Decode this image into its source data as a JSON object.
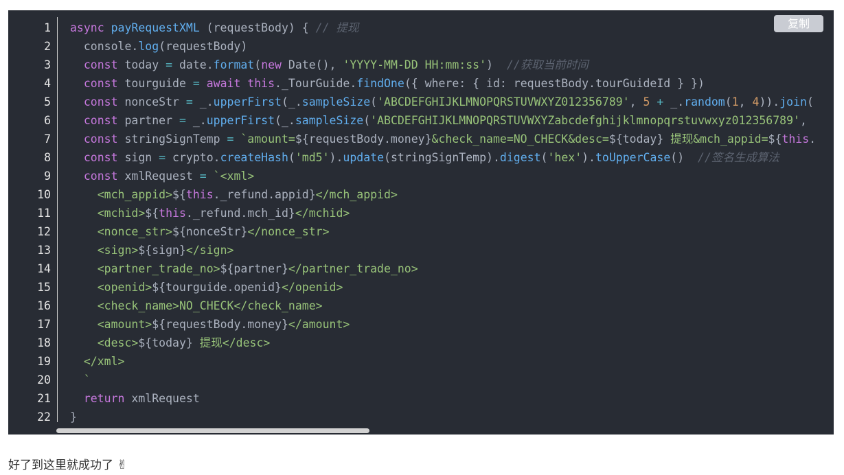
{
  "copy_button": {
    "label": "复制"
  },
  "line_numbers": [
    "1",
    "2",
    "3",
    "4",
    "5",
    "6",
    "7",
    "8",
    "9",
    "10",
    "11",
    "12",
    "13",
    "14",
    "15",
    "16",
    "17",
    "18",
    "19",
    "20",
    "21",
    "22"
  ],
  "code_lines": [
    [
      {
        "t": "kw",
        "v": "async "
      },
      {
        "t": "fn",
        "v": "payRequestXML"
      },
      {
        "t": "plain",
        "v": " (requestBody) { "
      },
      {
        "t": "cmt",
        "v": "// 提现"
      }
    ],
    [
      {
        "t": "plain",
        "v": "  console."
      },
      {
        "t": "fn",
        "v": "log"
      },
      {
        "t": "plain",
        "v": "(requestBody)"
      }
    ],
    [
      {
        "t": "plain",
        "v": "  "
      },
      {
        "t": "kw",
        "v": "const"
      },
      {
        "t": "plain",
        "v": " today "
      },
      {
        "t": "op",
        "v": "="
      },
      {
        "t": "plain",
        "v": " date."
      },
      {
        "t": "fn",
        "v": "format"
      },
      {
        "t": "plain",
        "v": "("
      },
      {
        "t": "kw",
        "v": "new"
      },
      {
        "t": "plain",
        "v": " Date(), "
      },
      {
        "t": "str",
        "v": "'YYYY-MM-DD HH:mm:ss'"
      },
      {
        "t": "plain",
        "v": ")  "
      },
      {
        "t": "cmt",
        "v": "//获取当前时间"
      }
    ],
    [
      {
        "t": "plain",
        "v": "  "
      },
      {
        "t": "kw",
        "v": "const"
      },
      {
        "t": "plain",
        "v": " tourguide "
      },
      {
        "t": "op",
        "v": "="
      },
      {
        "t": "plain",
        "v": " "
      },
      {
        "t": "kw",
        "v": "await this"
      },
      {
        "t": "plain",
        "v": "._TourGuide."
      },
      {
        "t": "fn",
        "v": "findOne"
      },
      {
        "t": "plain",
        "v": "({ where: { id: requestBody.tourGuideId } })"
      }
    ],
    [
      {
        "t": "plain",
        "v": "  "
      },
      {
        "t": "kw",
        "v": "const"
      },
      {
        "t": "plain",
        "v": " nonceStr "
      },
      {
        "t": "op",
        "v": "="
      },
      {
        "t": "plain",
        "v": " _."
      },
      {
        "t": "fn",
        "v": "upperFirst"
      },
      {
        "t": "plain",
        "v": "(_."
      },
      {
        "t": "fn",
        "v": "sampleSize"
      },
      {
        "t": "plain",
        "v": "("
      },
      {
        "t": "str",
        "v": "'ABCDEFGHIJKLMNOPQRSTUVWXYZ012356789'"
      },
      {
        "t": "plain",
        "v": ", "
      },
      {
        "t": "num",
        "v": "5"
      },
      {
        "t": "plain",
        "v": " "
      },
      {
        "t": "op",
        "v": "+"
      },
      {
        "t": "plain",
        "v": " _."
      },
      {
        "t": "fn",
        "v": "random"
      },
      {
        "t": "plain",
        "v": "("
      },
      {
        "t": "num",
        "v": "1"
      },
      {
        "t": "plain",
        "v": ", "
      },
      {
        "t": "num",
        "v": "4"
      },
      {
        "t": "plain",
        "v": "))."
      },
      {
        "t": "fn",
        "v": "join"
      },
      {
        "t": "plain",
        "v": "("
      }
    ],
    [
      {
        "t": "plain",
        "v": "  "
      },
      {
        "t": "kw",
        "v": "const"
      },
      {
        "t": "plain",
        "v": " partner "
      },
      {
        "t": "op",
        "v": "="
      },
      {
        "t": "plain",
        "v": " _."
      },
      {
        "t": "fn",
        "v": "upperFirst"
      },
      {
        "t": "plain",
        "v": "(_."
      },
      {
        "t": "fn",
        "v": "sampleSize"
      },
      {
        "t": "plain",
        "v": "("
      },
      {
        "t": "str",
        "v": "'ABCDEFGHIJKLMNOPQRSTUVWXYZabcdefghijklmnopqrstuvwxyz012356789'"
      },
      {
        "t": "plain",
        "v": ","
      }
    ],
    [
      {
        "t": "plain",
        "v": "  "
      },
      {
        "t": "kw",
        "v": "const"
      },
      {
        "t": "plain",
        "v": " stringSignTemp "
      },
      {
        "t": "op",
        "v": "="
      },
      {
        "t": "plain",
        "v": " "
      },
      {
        "t": "str",
        "v": "`amount="
      },
      {
        "t": "plain",
        "v": "${requestBody.money}"
      },
      {
        "t": "str",
        "v": "&check_name=NO_CHECK&desc="
      },
      {
        "t": "plain",
        "v": "${today}"
      },
      {
        "t": "str",
        "v": " 提现&mch_appid="
      },
      {
        "t": "plain",
        "v": "${"
      },
      {
        "t": "kw",
        "v": "this"
      },
      {
        "t": "plain",
        "v": "."
      }
    ],
    [
      {
        "t": "plain",
        "v": "  "
      },
      {
        "t": "kw",
        "v": "const"
      },
      {
        "t": "plain",
        "v": " sign "
      },
      {
        "t": "op",
        "v": "="
      },
      {
        "t": "plain",
        "v": " crypto."
      },
      {
        "t": "fn",
        "v": "createHash"
      },
      {
        "t": "plain",
        "v": "("
      },
      {
        "t": "str",
        "v": "'md5'"
      },
      {
        "t": "plain",
        "v": ")."
      },
      {
        "t": "fn",
        "v": "update"
      },
      {
        "t": "plain",
        "v": "(stringSignTemp)."
      },
      {
        "t": "fn",
        "v": "digest"
      },
      {
        "t": "plain",
        "v": "("
      },
      {
        "t": "str",
        "v": "'hex'"
      },
      {
        "t": "plain",
        "v": ")."
      },
      {
        "t": "fn",
        "v": "toUpperCase"
      },
      {
        "t": "plain",
        "v": "()  "
      },
      {
        "t": "cmt",
        "v": "//签名生成算法"
      }
    ],
    [
      {
        "t": "plain",
        "v": "  "
      },
      {
        "t": "kw",
        "v": "const"
      },
      {
        "t": "plain",
        "v": " xmlRequest "
      },
      {
        "t": "op",
        "v": "="
      },
      {
        "t": "plain",
        "v": " "
      },
      {
        "t": "str",
        "v": "`<xml>"
      }
    ],
    [
      {
        "t": "plain",
        "v": "    "
      },
      {
        "t": "str",
        "v": "<mch_appid>"
      },
      {
        "t": "plain",
        "v": "${"
      },
      {
        "t": "kw",
        "v": "this"
      },
      {
        "t": "plain",
        "v": "._refund.appid}"
      },
      {
        "t": "str",
        "v": "</mch_appid>"
      }
    ],
    [
      {
        "t": "plain",
        "v": "    "
      },
      {
        "t": "str",
        "v": "<mchid>"
      },
      {
        "t": "plain",
        "v": "${"
      },
      {
        "t": "kw",
        "v": "this"
      },
      {
        "t": "plain",
        "v": "._refund.mch_id}"
      },
      {
        "t": "str",
        "v": "</mchid>"
      }
    ],
    [
      {
        "t": "plain",
        "v": "    "
      },
      {
        "t": "str",
        "v": "<nonce_str>"
      },
      {
        "t": "plain",
        "v": "${nonceStr}"
      },
      {
        "t": "str",
        "v": "</nonce_str>"
      }
    ],
    [
      {
        "t": "plain",
        "v": "    "
      },
      {
        "t": "str",
        "v": "<sign>"
      },
      {
        "t": "plain",
        "v": "${sign}"
      },
      {
        "t": "str",
        "v": "</sign>"
      }
    ],
    [
      {
        "t": "plain",
        "v": "    "
      },
      {
        "t": "str",
        "v": "<partner_trade_no>"
      },
      {
        "t": "plain",
        "v": "${partner}"
      },
      {
        "t": "str",
        "v": "</partner_trade_no>"
      }
    ],
    [
      {
        "t": "plain",
        "v": "    "
      },
      {
        "t": "str",
        "v": "<openid>"
      },
      {
        "t": "plain",
        "v": "${tourguide.openid}"
      },
      {
        "t": "str",
        "v": "</openid>"
      }
    ],
    [
      {
        "t": "plain",
        "v": "    "
      },
      {
        "t": "str",
        "v": "<check_name>NO_CHECK</check_name>"
      }
    ],
    [
      {
        "t": "plain",
        "v": "    "
      },
      {
        "t": "str",
        "v": "<amount>"
      },
      {
        "t": "plain",
        "v": "${requestBody.money}"
      },
      {
        "t": "str",
        "v": "</amount>"
      }
    ],
    [
      {
        "t": "plain",
        "v": "    "
      },
      {
        "t": "str",
        "v": "<desc>"
      },
      {
        "t": "plain",
        "v": "${today}"
      },
      {
        "t": "str",
        "v": " 提现</desc>"
      }
    ],
    [
      {
        "t": "plain",
        "v": "  "
      },
      {
        "t": "str",
        "v": "</xml>"
      }
    ],
    [
      {
        "t": "plain",
        "v": "  "
      },
      {
        "t": "str",
        "v": "`"
      }
    ],
    [
      {
        "t": "plain",
        "v": "  "
      },
      {
        "t": "kw",
        "v": "return"
      },
      {
        "t": "plain",
        "v": " xmlRequest"
      }
    ],
    [
      {
        "t": "plain",
        "v": "}"
      }
    ]
  ],
  "caption": {
    "text": "好了到这里就成功了",
    "emoji": "✌"
  },
  "colors": {
    "background": "#282c34",
    "keyword": "#c678dd",
    "function": "#61aeee",
    "string": "#98c379",
    "number": "#d19a66",
    "comment": "#5c6370"
  }
}
